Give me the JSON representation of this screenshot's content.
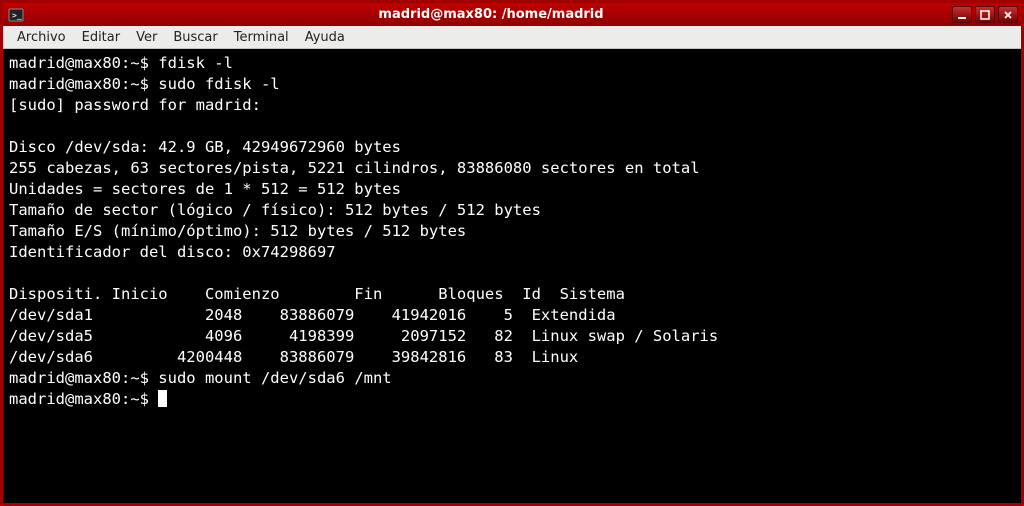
{
  "titlebar": {
    "title": "madrid@max80: /home/madrid"
  },
  "menu": {
    "items": [
      "Archivo",
      "Editar",
      "Ver",
      "Buscar",
      "Terminal",
      "Ayuda"
    ]
  },
  "term": {
    "l01": "madrid@max80:~$ fdisk -l",
    "l02": "madrid@max80:~$ sudo fdisk -l",
    "l03": "[sudo] password for madrid: ",
    "l04": "",
    "l05": "Disco /dev/sda: 42.9 GB, 42949672960 bytes",
    "l06": "255 cabezas, 63 sectores/pista, 5221 cilindros, 83886080 sectores en total",
    "l07": "Unidades = sectores de 1 * 512 = 512 bytes",
    "l08": "Tamaño de sector (lógico / físico): 512 bytes / 512 bytes",
    "l09": "Tamaño E/S (mínimo/óptimo): 512 bytes / 512 bytes",
    "l10": "Identificador del disco: 0x74298697",
    "l11": "",
    "l12": "Dispositi. Inicio    Comienzo        Fin      Bloques  Id  Sistema",
    "l13": "/dev/sda1            2048    83886079    41942016    5  Extendida",
    "l14": "/dev/sda5            4096     4198399     2097152   82  Linux swap / Solaris",
    "l15": "/dev/sda6         4200448    83886079    39842816   83  Linux",
    "l16": "madrid@max80:~$ sudo mount /dev/sda6 /mnt",
    "l17": "madrid@max80:~$ "
  }
}
